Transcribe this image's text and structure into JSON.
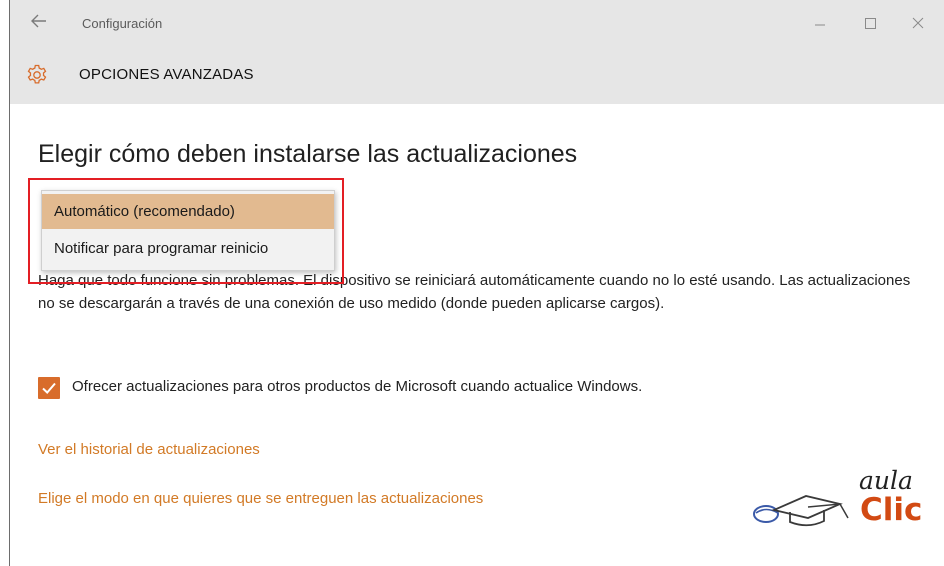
{
  "window": {
    "title": "Configuración",
    "back_icon": "arrow-left-icon",
    "minimize_icon": "minimize-icon",
    "maximize_icon": "maximize-icon",
    "close_icon": "close-icon"
  },
  "header": {
    "icon": "gear-icon",
    "title": "OPCIONES AVANZADAS"
  },
  "main": {
    "heading": "Elegir cómo deben instalarse las actualizaciones",
    "dropdown": {
      "options": [
        "Automático (recomendado)",
        "Notificar para programar reinicio"
      ],
      "selected": "Automático (recomendado)"
    },
    "description_visible": "Haga que todo funcione sin problemas. El dispositivo se reiniciará automáticamente cuando no lo esté usando. Las actualizaciones no se descargarán a través de una conexión de uso medido (donde pueden aplicarse cargos).",
    "checkbox": {
      "checked": true,
      "label": "Ofrecer actualizaciones para otros productos de Microsoft cuando actualice Windows."
    },
    "links": [
      "Ver el historial de actualizaciones",
      "Elige el modo en que quieres que se entreguen las actualizaciones"
    ]
  },
  "watermark": {
    "line1": "aula",
    "line2": "Clic"
  },
  "colors": {
    "accent": "#d86c2b",
    "link": "#d27a26",
    "selection": "#e2ba90",
    "highlight_border": "#e31e24",
    "chrome": "#e6e6e6"
  }
}
